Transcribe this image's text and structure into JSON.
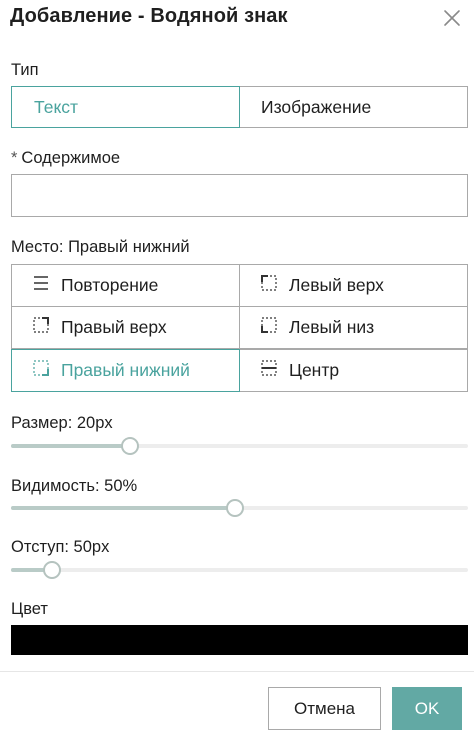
{
  "dialog": {
    "title": "Добавление - Водяной знак",
    "close_icon": "close-icon"
  },
  "type": {
    "label": "Тип",
    "options": [
      "Текст",
      "Изображение"
    ],
    "selected": "Текст"
  },
  "content": {
    "required_mark": "*",
    "label": "Содержимое",
    "value": "",
    "placeholder": ""
  },
  "position": {
    "label": "Место: Правый нижний",
    "options": [
      {
        "label": "Повторение",
        "icon": "repeat-icon"
      },
      {
        "label": "Левый верх",
        "icon": "top-left-corner-icon"
      },
      {
        "label": "Правый верх",
        "icon": "top-right-corner-icon"
      },
      {
        "label": "Левый низ",
        "icon": "bottom-left-corner-icon"
      },
      {
        "label": "Правый нижний",
        "icon": "bottom-right-corner-icon"
      },
      {
        "label": "Центр",
        "icon": "center-icon"
      }
    ],
    "selected": "Правый нижний"
  },
  "size": {
    "label": "Размер: 20px",
    "fraction": 0.26
  },
  "opacity": {
    "label": "Видимость: 50%",
    "fraction": 0.49
  },
  "offset": {
    "label": "Отступ: 50px",
    "fraction": 0.09
  },
  "color": {
    "label": "Цвет",
    "value": "#000000"
  },
  "footer": {
    "cancel_label": "Отмена",
    "ok_label": "OK"
  },
  "theme": {
    "accent": "#4aa39e",
    "ok_button": "#62a9a4"
  }
}
